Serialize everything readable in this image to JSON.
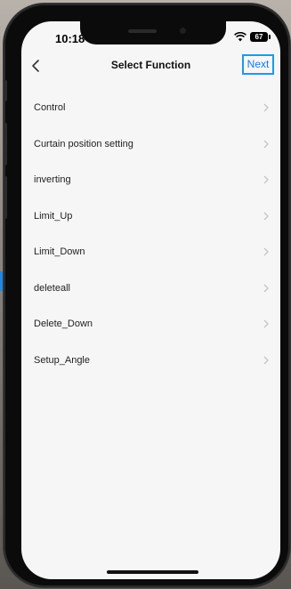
{
  "status_bar": {
    "time": "10:18",
    "battery": "67"
  },
  "nav": {
    "title": "Select Function",
    "next_label": "Next"
  },
  "functions": [
    {
      "label": "Control"
    },
    {
      "label": "Curtain position setting"
    },
    {
      "label": "inverting"
    },
    {
      "label": "Limit_Up"
    },
    {
      "label": "Limit_Down"
    },
    {
      "label": "deleteall"
    },
    {
      "label": "Delete_Down"
    },
    {
      "label": "Setup_Angle"
    }
  ],
  "icons": {
    "back": "chevron-left-icon",
    "row": "chevron-right-icon",
    "wifi": "wifi-icon",
    "battery": "battery-icon"
  },
  "colors": {
    "accent": "#1677ff",
    "highlight_border": "#1a9be6",
    "screen_bg": "#f6f6f6"
  }
}
